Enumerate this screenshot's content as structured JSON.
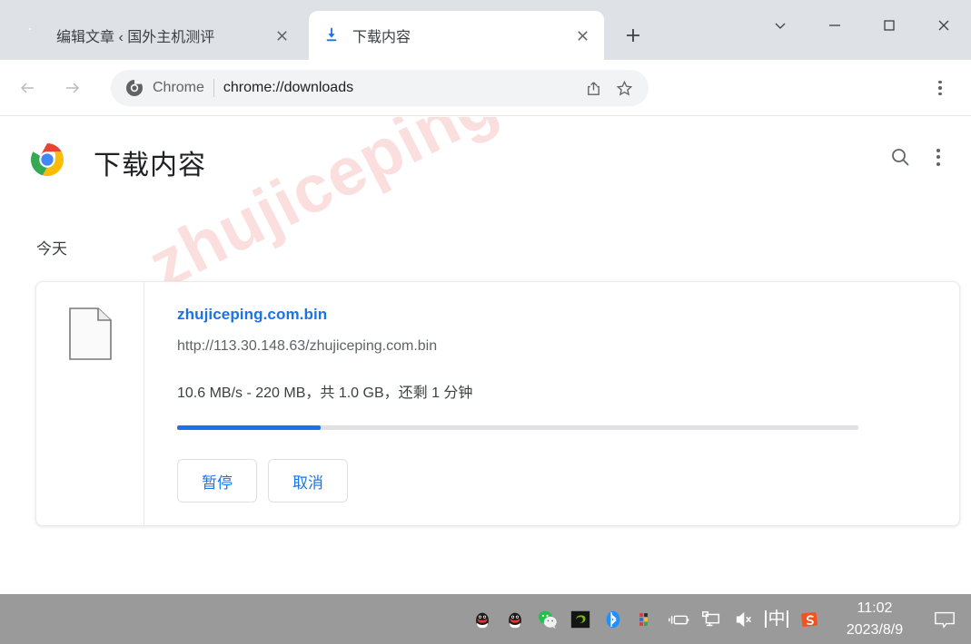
{
  "window": {
    "controls": [
      {
        "name": "tab-search",
        "icon": "chevron-down-icon"
      },
      {
        "name": "minimize",
        "icon": "minimize-icon"
      },
      {
        "name": "maximize",
        "icon": "maximize-icon"
      },
      {
        "name": "close",
        "icon": "close-icon"
      }
    ]
  },
  "tabs": [
    {
      "title": "编辑文章 ‹ 国外主机测评",
      "favicon": "seal-favicon",
      "active": false
    },
    {
      "title": "下载内容",
      "favicon": "download-icon",
      "active": true
    }
  ],
  "newtab_label": "+",
  "toolbar": {
    "back": "back-arrow-icon",
    "forward": "forward-arrow-icon",
    "reload": "reload-icon",
    "omnibox": {
      "scheme_label": "Chrome",
      "url": "chrome://downloads",
      "share_icon": "share-icon",
      "bookmark_icon": "star-icon"
    },
    "menu_icon": "three-dot-menu-icon"
  },
  "page": {
    "title": "下载内容",
    "logo": "chrome-logo",
    "search_icon": "search-icon",
    "menu_icon": "three-dot-menu-icon",
    "watermark": "zhujiceping.com",
    "day_heading": "今天",
    "download": {
      "file_icon": "document-file-icon",
      "filename": "zhujiceping.com.bin",
      "url": "http://113.30.148.63/zhujiceping.com.bin",
      "status": "10.6 MB/s - 220 MB，共 1.0 GB，还剩 1 分钟",
      "progress_percent": 21,
      "progress_color": "#1a73e8",
      "buttons": [
        {
          "label": "暂停",
          "name": "pause-button"
        },
        {
          "label": "取消",
          "name": "cancel-button"
        }
      ]
    }
  },
  "taskbar": {
    "tray_icons": [
      "qq-icon",
      "qq-icon",
      "wechat-icon",
      "nvidia-icon",
      "bluetooth-icon",
      "color-grid-icon",
      "battery-charging-icon",
      "display-icon",
      "volume-mute-icon"
    ],
    "ime_label": "中",
    "sogou_label": "S",
    "time": "11:02",
    "date": "2023/8/9",
    "notification_icon": "notification-bubble-icon",
    "background_color": "#9a9a9a"
  }
}
